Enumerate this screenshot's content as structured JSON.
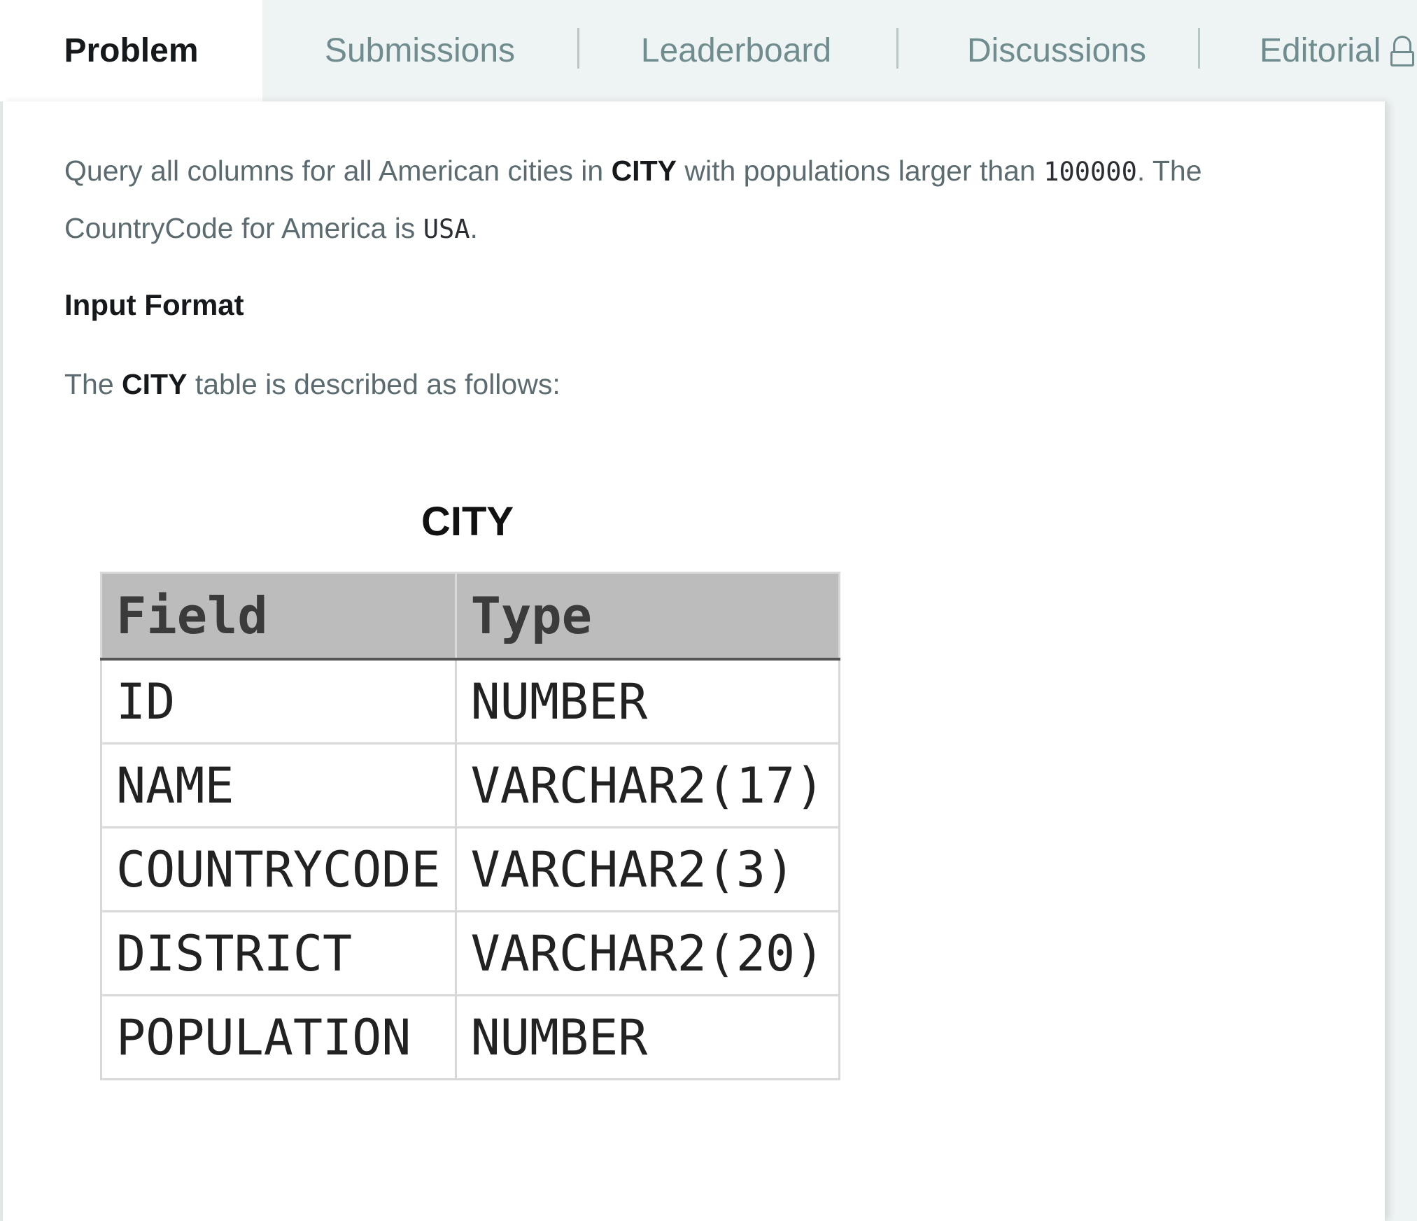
{
  "tabs": [
    {
      "label": "Problem",
      "active": true
    },
    {
      "label": "Submissions",
      "active": false
    },
    {
      "label": "Leaderboard",
      "active": false
    },
    {
      "label": "Discussions",
      "active": false
    },
    {
      "label": "Editorial",
      "active": false,
      "icon": "lock-icon"
    }
  ],
  "problem": {
    "line1_a": "Query all columns for all American cities in ",
    "line1_b": "CITY",
    "line1_c": " with populations larger than ",
    "line1_d": "100000",
    "line1_e": ". The",
    "line2_a": "CountryCode for America is ",
    "line2_b": "USA",
    "line2_c": ".",
    "input_heading": "Input Format",
    "desc_a": "The ",
    "desc_b": "CITY",
    "desc_c": " table is described as follows:"
  },
  "table": {
    "caption": "CITY",
    "headers": [
      "Field",
      "Type"
    ],
    "rows": [
      [
        "ID",
        "NUMBER"
      ],
      [
        "NAME",
        "VARCHAR2(17)"
      ],
      [
        "COUNTRYCODE",
        "VARCHAR2(3)"
      ],
      [
        "DISTRICT",
        "VARCHAR2(20)"
      ],
      [
        "POPULATION",
        "NUMBER"
      ]
    ]
  },
  "colors": {
    "tab_bg": "#eef3f3",
    "tab_text": "#6f8c8e",
    "active_text": "#16191c",
    "body_text": "#5b6b6f"
  }
}
